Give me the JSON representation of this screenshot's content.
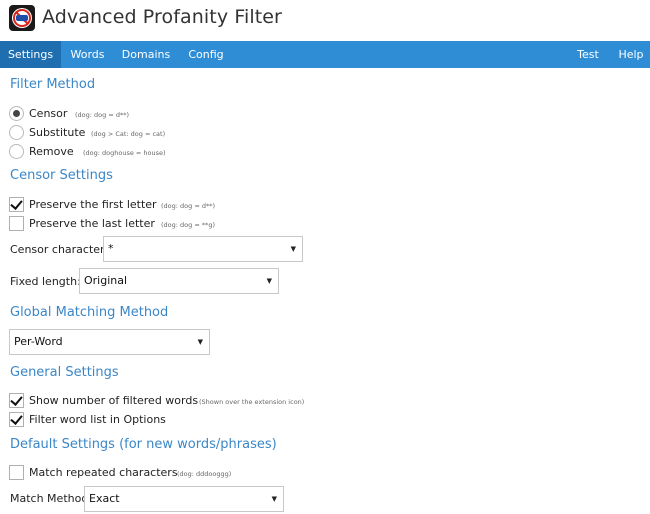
{
  "app": {
    "title": "Advanced Profanity Filter",
    "logo_icon": "profanity-filter-logo-icon"
  },
  "nav": {
    "items": [
      {
        "label": "Settings",
        "active": true
      },
      {
        "label": "Words"
      },
      {
        "label": "Domains"
      },
      {
        "label": "Config"
      },
      {
        "label": "Test"
      },
      {
        "label": "Help"
      }
    ],
    "color": "#2f8dd6",
    "active_color": "#1f6fb0"
  },
  "filter_method": {
    "title": "Filter Method",
    "options": [
      {
        "label": "Censor",
        "hint": "(dog: dog = d**)",
        "selected": true
      },
      {
        "label": "Substitute",
        "hint": "(dog > Cat: dog = cat)",
        "selected": false
      },
      {
        "label": "Remove",
        "hint": "(dog: doghouse = house)",
        "selected": false
      }
    ]
  },
  "censor_settings": {
    "title": "Censor Settings",
    "preserve_first": {
      "label": "Preserve the first letter",
      "hint": "(dog: dog = d**)",
      "checked": true
    },
    "preserve_last": {
      "label": "Preserve the last letter",
      "hint": "(dog: dog = **g)",
      "checked": false
    },
    "censor_character": {
      "label": "Censor character:",
      "value": "*"
    },
    "fixed_length": {
      "label": "Fixed length:",
      "value": "Original"
    }
  },
  "global_matching": {
    "title": "Global Matching Method",
    "value": "Per-Word"
  },
  "general_settings": {
    "title": "General Settings",
    "show_count": {
      "label": "Show number of filtered words",
      "hint": "(Shown over the extension icon)",
      "checked": true
    },
    "filter_list": {
      "label": "Filter word list in Options",
      "checked": true
    }
  },
  "default_settings": {
    "title": "Default Settings (for new words/phrases)",
    "match_repeated": {
      "label": "Match repeated characters",
      "hint": "(dog: dddooggg)",
      "checked": false
    },
    "match_method": {
      "label": "Match Method",
      "value": "Exact"
    }
  },
  "accent_color": "#3a87c8"
}
